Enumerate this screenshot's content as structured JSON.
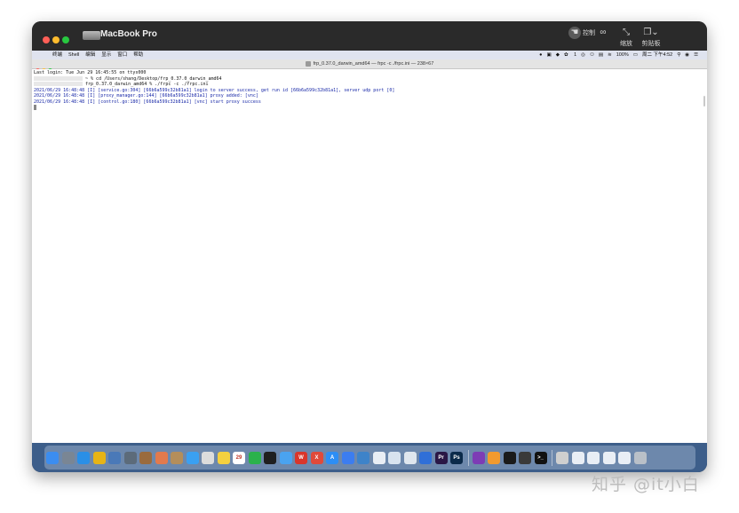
{
  "window": {
    "app_title": "MacBook Pro",
    "toolbar": [
      {
        "label": "控制",
        "icon": "pointer-icon"
      },
      {
        "label": "",
        "icon": "binoculars-icon"
      },
      {
        "label": "缩放",
        "icon": "resize-icon"
      },
      {
        "label": "剪贴板",
        "icon": "clipboard-icon"
      }
    ]
  },
  "menubar": {
    "items": [
      "终端",
      "Shell",
      "编辑",
      "显示",
      "窗口",
      "帮助"
    ],
    "status": {
      "battery": "100%",
      "clock": "周二 下午4:52",
      "wechat_count": "1"
    }
  },
  "terminal": {
    "title": "frp_0.37.0_darwin_amd64 — frpc -c ./frpc.ini — 238×67",
    "lines": [
      "Last login: Tue Jun 29 16:45:55 on ttys000",
      "~ % cd /Users/shang/Desktop/frp_0.37.0_darwin_amd64",
      "frp_0.37.0_darwin_amd64 % ./frpc -c ./frpc.ini",
      "2021/06/29 16:48:48 [I] [service.go:304] [66b6a599c32b81a1] login to server success, get run id [66b6a599c32b81a1], server udp port [0]",
      "2021/06/29 16:48:48 [I] [proxy_manager.go:144] [66b6a599c32b81a1] proxy added: [vnc]",
      "2021/06/29 16:48:48 [I] [control.go:180] [66b6a599c32b81a1] [vnc] start proxy success"
    ]
  },
  "dock": {
    "apps": [
      {
        "name": "finder",
        "color": "#3b8df0",
        "glyph": ""
      },
      {
        "name": "launchpad",
        "color": "#7a8694",
        "glyph": ""
      },
      {
        "name": "safari",
        "color": "#2a8fe6",
        "glyph": ""
      },
      {
        "name": "chrome",
        "color": "#e7b416",
        "glyph": ""
      },
      {
        "name": "preview",
        "color": "#4a79b8",
        "glyph": ""
      },
      {
        "name": "image-capture",
        "color": "#5c6b7a",
        "glyph": ""
      },
      {
        "name": "notebook",
        "color": "#9a6b3e",
        "glyph": ""
      },
      {
        "name": "photos",
        "color": "#e27a4d",
        "glyph": ""
      },
      {
        "name": "contacts",
        "color": "#b48e5b",
        "glyph": ""
      },
      {
        "name": "messages",
        "color": "#3aa0f2",
        "glyph": ""
      },
      {
        "name": "textedit",
        "color": "#dcdcdc",
        "glyph": ""
      },
      {
        "name": "notes",
        "color": "#f4d03f",
        "glyph": ""
      },
      {
        "name": "calendar",
        "color": "#ffffff",
        "glyph": "29"
      },
      {
        "name": "wechat",
        "color": "#2bb24c",
        "glyph": ""
      },
      {
        "name": "qq",
        "color": "#1f1f1f",
        "glyph": ""
      },
      {
        "name": "tim",
        "color": "#4aa3f0",
        "glyph": ""
      },
      {
        "name": "wps",
        "color": "#d9362b",
        "glyph": "W"
      },
      {
        "name": "xmind",
        "color": "#e04a3a",
        "glyph": "X"
      },
      {
        "name": "app-store",
        "color": "#2d8ef5",
        "glyph": "A"
      },
      {
        "name": "lark",
        "color": "#3c7df0",
        "glyph": ""
      },
      {
        "name": "vscode-alt",
        "color": "#3e83c9",
        "glyph": ""
      },
      {
        "name": "baidu-netdisk",
        "color": "#e9eef5",
        "glyph": ""
      },
      {
        "name": "syncthing",
        "color": "#d8e3ef",
        "glyph": ""
      },
      {
        "name": "clash",
        "color": "#dfe6ee",
        "glyph": ""
      },
      {
        "name": "vpn",
        "color": "#2f6fd8",
        "glyph": ""
      },
      {
        "name": "premiere",
        "color": "#2a1746",
        "glyph": "Pr"
      },
      {
        "name": "photoshop",
        "color": "#0b2a4a",
        "glyph": "Ps"
      },
      {
        "name": "onenote",
        "color": "#7d3cb5",
        "glyph": ""
      },
      {
        "name": "pages",
        "color": "#f29a2e",
        "glyph": ""
      },
      {
        "name": "vnc",
        "color": "#1a1a1a",
        "glyph": ""
      },
      {
        "name": "quicktime",
        "color": "#3a3a3a",
        "glyph": ""
      },
      {
        "name": "terminal",
        "color": "#111111",
        "glyph": ">_"
      },
      {
        "name": "activity-monitor",
        "color": "#cfcfcf",
        "glyph": ""
      },
      {
        "name": "folder-1",
        "color": "#e9eef5",
        "glyph": ""
      },
      {
        "name": "folder-2",
        "color": "#e9eef5",
        "glyph": ""
      },
      {
        "name": "folder-3",
        "color": "#e9eef5",
        "glyph": ""
      },
      {
        "name": "folder-4",
        "color": "#e9eef5",
        "glyph": ""
      },
      {
        "name": "trash",
        "color": "#b9c0c8",
        "glyph": ""
      }
    ]
  },
  "watermark": "知乎 @it小白"
}
